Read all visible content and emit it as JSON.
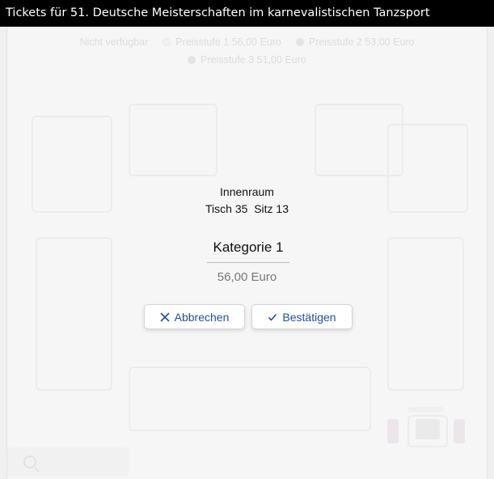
{
  "window": {
    "title": "Tickets für 51. Deutsche Meisterschaften im karnevalistischen Tanzsport"
  },
  "legend": {
    "items": [
      {
        "label": "Nicht verfügbar"
      },
      {
        "label": "Preisstufe 1 56,00 Euro"
      },
      {
        "label": "Preisstufe 2 53,00 Euro"
      },
      {
        "label": "Preisstufe 3 51,00 Euro"
      }
    ]
  },
  "seat_dialog": {
    "section": "Innenraum",
    "table_label": "Tisch",
    "table_number": "35",
    "seat_label": "Sitz",
    "seat_number": "13",
    "category": "Kategorie 1",
    "price": "56,00 Euro",
    "cancel_label": "Abbrechen",
    "confirm_label": "Bestätigen"
  },
  "colors": {
    "accent": "#1f4fa6",
    "titlebar_bg": "#000000"
  }
}
